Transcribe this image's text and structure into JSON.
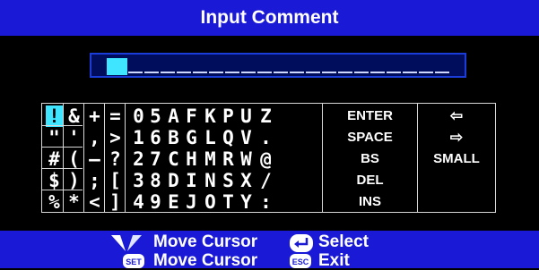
{
  "title": "Input Comment",
  "input": {
    "value": ""
  },
  "keyboard": {
    "rows": [
      [
        "!",
        "&",
        "+",
        "=",
        "0",
        "5",
        "A",
        "F",
        "K",
        "P",
        "U",
        "Z"
      ],
      [
        "\"",
        "'",
        ",",
        ">",
        "1",
        "6",
        "B",
        "G",
        "L",
        "Q",
        "V",
        "."
      ],
      [
        "#",
        "(",
        "—",
        "?",
        "2",
        "7",
        "C",
        "H",
        "M",
        "R",
        "W",
        "@"
      ],
      [
        "$",
        ")",
        ";",
        "[",
        "3",
        "8",
        "D",
        "I",
        "N",
        "S",
        "X",
        "/"
      ],
      [
        "%",
        "*",
        "<",
        "]",
        "4",
        "9",
        "E",
        "J",
        "O",
        "T",
        "Y",
        ":"
      ]
    ],
    "selected": "!",
    "commands": [
      "ENTER",
      "SPACE",
      "BS",
      "DEL",
      "INS"
    ],
    "nav": [
      {
        "label": "⇦",
        "icon": "left-arrow-icon"
      },
      {
        "label": "⇨",
        "icon": "right-arrow-icon"
      },
      {
        "label": "SMALL",
        "icon": ""
      }
    ]
  },
  "footer": {
    "move_cursor_1": "Move Cursor",
    "select": "Select",
    "move_cursor_2": "Move Cursor",
    "exit": "Exit",
    "set_label": "SET",
    "esc_label": "ESC"
  },
  "colors": {
    "bar": "#1a1ad6",
    "highlight": "#3fe4ff",
    "background": "#000000"
  }
}
